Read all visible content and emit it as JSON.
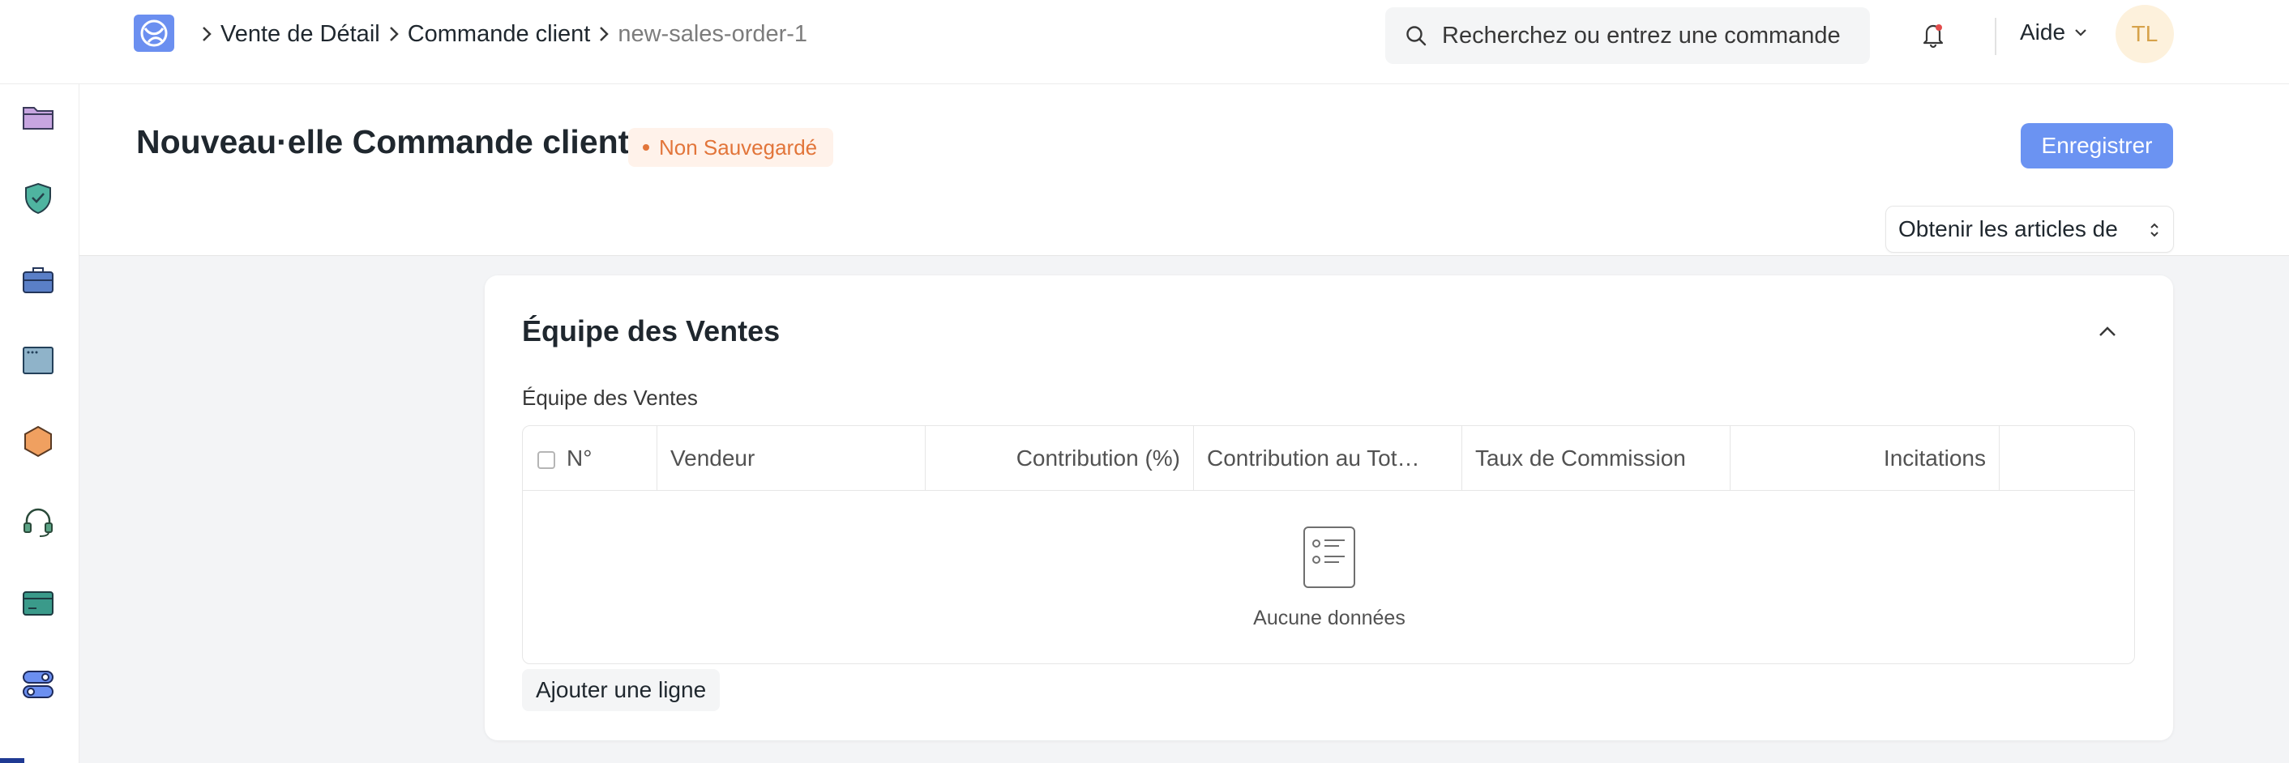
{
  "breadcrumb": {
    "items": [
      "Vente de Détail",
      "Commande client"
    ],
    "current": "new-sales-order-1"
  },
  "search": {
    "placeholder": "Recherchez ou entrez une commande"
  },
  "help": {
    "label": "Aide"
  },
  "user": {
    "initials": "TL"
  },
  "page": {
    "title": "Nouveau·elle Commande client",
    "status": "Non Sauvegardé",
    "save_label": "Enregistrer",
    "get_items_label": "Obtenir les articles de"
  },
  "section": {
    "title": "Équipe des Ventes",
    "field_label": "Équipe des Ventes",
    "columns": [
      "N°",
      "Vendeur",
      "Contribution (%)",
      "Contribution au Tot…",
      "Taux de Commission",
      "Incitations"
    ],
    "empty_text": "Aucune données",
    "add_row_label": "Ajouter une ligne"
  },
  "colors": {
    "accent": "#6b93f2",
    "status_orange": "#e2753a",
    "avatar_bg": "#fdf1dc"
  },
  "sidebar_icons": [
    "folder-icon",
    "shield-check-icon",
    "briefcase-icon",
    "browser-window-icon",
    "hexagon-icon",
    "headset-icon",
    "card-icon",
    "toggles-icon"
  ]
}
